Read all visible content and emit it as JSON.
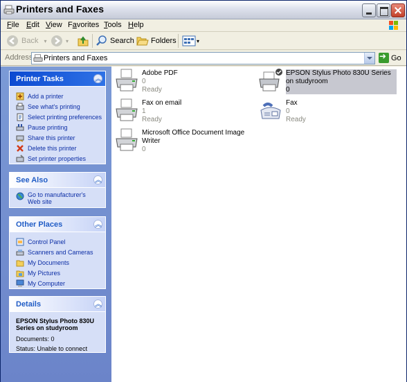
{
  "window": {
    "title": "Printers and Faxes"
  },
  "menu": {
    "items": [
      {
        "label": "File"
      },
      {
        "label": "Edit"
      },
      {
        "label": "View"
      },
      {
        "label": "Favorites"
      },
      {
        "label": "Tools"
      },
      {
        "label": "Help"
      }
    ]
  },
  "toolbar": {
    "back": "Back",
    "search": "Search",
    "folders": "Folders"
  },
  "address": {
    "label": "Address",
    "value": "Printers and Faxes",
    "go": "Go"
  },
  "sidebar": {
    "printer_tasks": {
      "title": "Printer Tasks",
      "items": [
        {
          "label": "Add a printer"
        },
        {
          "label": "See what's printing"
        },
        {
          "label": "Select printing preferences"
        },
        {
          "label": "Pause printing"
        },
        {
          "label": "Share this printer"
        },
        {
          "label": "Delete this printer"
        },
        {
          "label": "Set printer properties"
        }
      ]
    },
    "see_also": {
      "title": "See Also",
      "items": [
        {
          "label": "Go to manufacturer's Web site"
        }
      ]
    },
    "other_places": {
      "title": "Other Places",
      "items": [
        {
          "label": "Control Panel"
        },
        {
          "label": "Scanners and Cameras"
        },
        {
          "label": "My Documents"
        },
        {
          "label": "My Pictures"
        },
        {
          "label": "My Computer"
        }
      ]
    },
    "details": {
      "title": "Details",
      "name": "EPSON Stylus Photo 830U Series on studyroom",
      "documents": "Documents: 0",
      "status": "Status: Unable to connect"
    }
  },
  "printers": [
    {
      "name": "Adobe PDF",
      "docs": "0",
      "status": "Ready"
    },
    {
      "name": "EPSON Stylus Photo 830U Series on studyroom",
      "docs": "0",
      "status": ""
    },
    {
      "name": "Fax on email",
      "docs": "1",
      "status": "Ready"
    },
    {
      "name": "Fax",
      "docs": "0",
      "status": "Ready"
    },
    {
      "name": "Microsoft Office Document Image Writer",
      "docs": "0",
      "status": ""
    }
  ]
}
